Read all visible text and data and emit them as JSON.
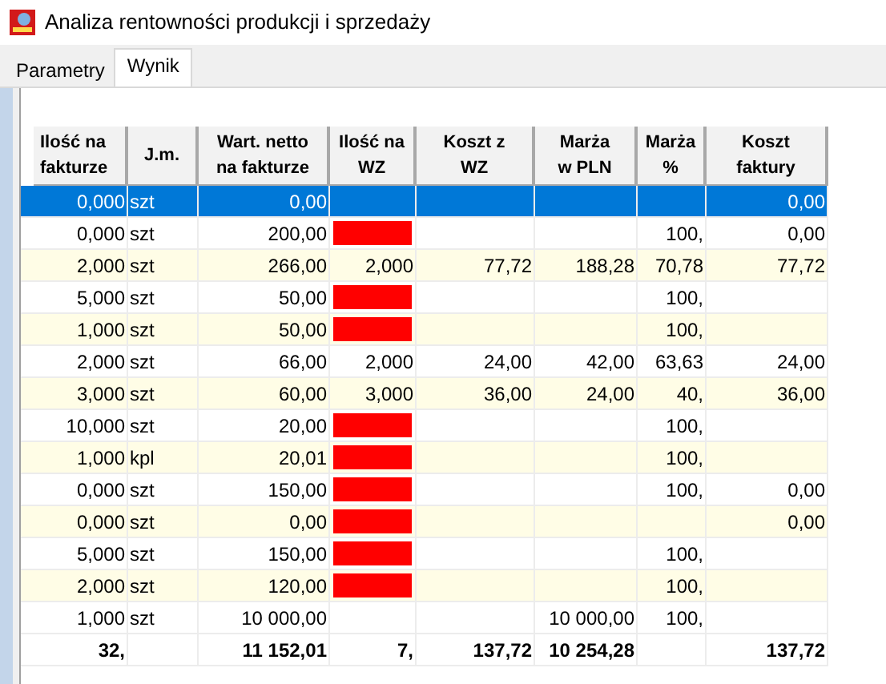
{
  "window": {
    "title": "Analiza rentowności produkcji i sprzedaży"
  },
  "tabs": [
    {
      "label": "Parametry",
      "selected": false
    },
    {
      "label": "Wynik",
      "selected": true
    }
  ],
  "table": {
    "columns": [
      "Ilość na fakturze",
      "J.m.",
      "Wart. netto na fakturze",
      "Ilość na WZ",
      "Koszt z WZ",
      "Marża w PLN",
      "Marża %",
      "Koszt faktury"
    ],
    "rows": [
      {
        "selected": true,
        "wz_missing": false,
        "cells": [
          "0,000",
          "szt",
          "0,00",
          null,
          null,
          null,
          null,
          "0,00"
        ]
      },
      {
        "selected": false,
        "wz_missing": true,
        "cells": [
          "0,000",
          "szt",
          "200,00",
          null,
          null,
          null,
          "100,",
          "0,00"
        ]
      },
      {
        "selected": false,
        "wz_missing": false,
        "cells": [
          "2,000",
          "szt",
          "266,00",
          "2,000",
          "77,72",
          "188,28",
          "70,78",
          "77,72"
        ]
      },
      {
        "selected": false,
        "wz_missing": true,
        "cells": [
          "5,000",
          "szt",
          "50,00",
          null,
          null,
          null,
          "100,",
          null
        ]
      },
      {
        "selected": false,
        "wz_missing": true,
        "cells": [
          "1,000",
          "szt",
          "50,00",
          null,
          null,
          null,
          "100,",
          null
        ]
      },
      {
        "selected": false,
        "wz_missing": false,
        "cells": [
          "2,000",
          "szt",
          "66,00",
          "2,000",
          "24,00",
          "42,00",
          "63,63",
          "24,00"
        ]
      },
      {
        "selected": false,
        "wz_missing": false,
        "cells": [
          "3,000",
          "szt",
          "60,00",
          "3,000",
          "36,00",
          "24,00",
          "40,",
          "36,00"
        ]
      },
      {
        "selected": false,
        "wz_missing": true,
        "cells": [
          "10,000",
          "szt",
          "20,00",
          null,
          null,
          null,
          "100,",
          null
        ]
      },
      {
        "selected": false,
        "wz_missing": true,
        "cells": [
          "1,000",
          "kpl",
          "20,01",
          null,
          null,
          null,
          "100,",
          null
        ]
      },
      {
        "selected": false,
        "wz_missing": true,
        "cells": [
          "0,000",
          "szt",
          "150,00",
          null,
          null,
          null,
          "100,",
          "0,00"
        ]
      },
      {
        "selected": false,
        "wz_missing": true,
        "cells": [
          "0,000",
          "szt",
          "0,00",
          null,
          null,
          null,
          null,
          "0,00"
        ]
      },
      {
        "selected": false,
        "wz_missing": true,
        "cells": [
          "5,000",
          "szt",
          "150,00",
          null,
          null,
          null,
          "100,",
          null
        ]
      },
      {
        "selected": false,
        "wz_missing": true,
        "cells": [
          "2,000",
          "szt",
          "120,00",
          null,
          null,
          null,
          "100,",
          null
        ]
      },
      {
        "selected": false,
        "wz_missing": false,
        "cells": [
          "1,000",
          "szt",
          "10 000,00",
          null,
          null,
          "10 000,00",
          "100,",
          null
        ]
      }
    ],
    "totals": {
      "quantity": "32,",
      "net_value": "11 152,01",
      "wz_quantity": "7,",
      "wz_cost": "137,72",
      "margin_pln": "10 254,28",
      "invoice_cost": "137,72"
    }
  }
}
